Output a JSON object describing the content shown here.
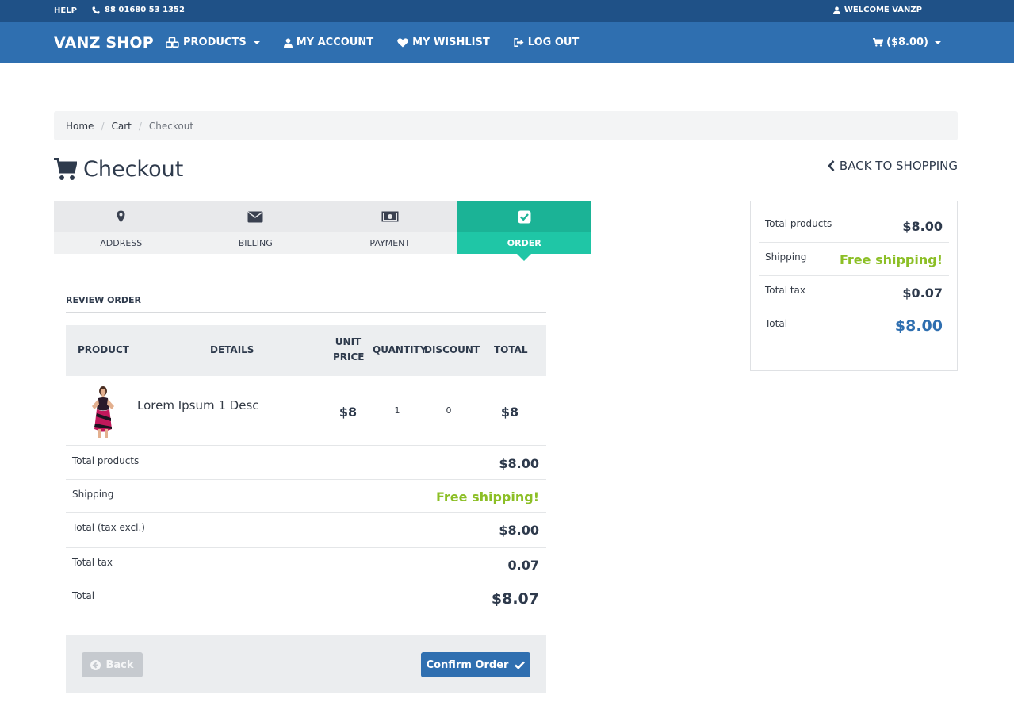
{
  "topbar": {
    "help": "HELP",
    "phone": "88 01680 53 1352",
    "welcome": "WELCOME VANZP"
  },
  "navbar": {
    "brand": "VANZ SHOP",
    "items": [
      {
        "label": "PRODUCTS",
        "icon": "cubes-icon"
      },
      {
        "label": "MY ACCOUNT",
        "icon": "user-icon"
      },
      {
        "label": "MY WISHLIST",
        "icon": "heart-icon"
      },
      {
        "label": "LOG OUT",
        "icon": "logout-icon"
      }
    ],
    "cart": "($8.00)"
  },
  "breadcrumb": {
    "items": [
      "Home",
      "Cart",
      "Checkout"
    ]
  },
  "page": {
    "title": "Checkout",
    "back_to_shopping": "BACK TO SHOPPING"
  },
  "steps": [
    {
      "label": "ADDRESS",
      "icon": "map-marker-icon"
    },
    {
      "label": "BILLING",
      "icon": "envelope-icon"
    },
    {
      "label": "PAYMENT",
      "icon": "money-icon"
    },
    {
      "label": "ORDER",
      "icon": "check-square-icon",
      "active": true
    }
  ],
  "review": {
    "title": "REVIEW ORDER",
    "headers": {
      "product": "PRODUCT",
      "details": "DETAILS",
      "unit_price_1": "UNIT",
      "unit_price_2": "PRICE",
      "quantity": "QUANTITY",
      "discount": "DISCOUNT",
      "total": "TOTAL"
    },
    "item": {
      "name": "Lorem Ipsum 1 Desc",
      "unit_price": "$8",
      "quantity": "1",
      "discount": "0",
      "total": "$8"
    },
    "summary": {
      "total_products_label": "Total products",
      "total_products": "$8.00",
      "shipping_label": "Shipping",
      "shipping": "Free shipping!",
      "tax_excl_label": "Total (tax excl.)",
      "tax_excl": "$8.00",
      "total_tax_label": "Total tax",
      "total_tax": "0.07",
      "total_label": "Total",
      "total": "$8.07"
    },
    "buttons": {
      "back": "Back",
      "confirm": "Confirm Order"
    }
  },
  "side_summary": {
    "total_products_label": "Total products",
    "total_products": "$8.00",
    "shipping_label": "Shipping",
    "shipping": "Free shipping!",
    "total_tax_label": "Total tax",
    "total_tax": "$0.07",
    "total_label": "Total",
    "total": "$8.00"
  },
  "colors": {
    "topbar": "#1f5187",
    "navbar": "#2f6fb0",
    "accent": "#1fc6a6",
    "green": "#8cbf26"
  }
}
